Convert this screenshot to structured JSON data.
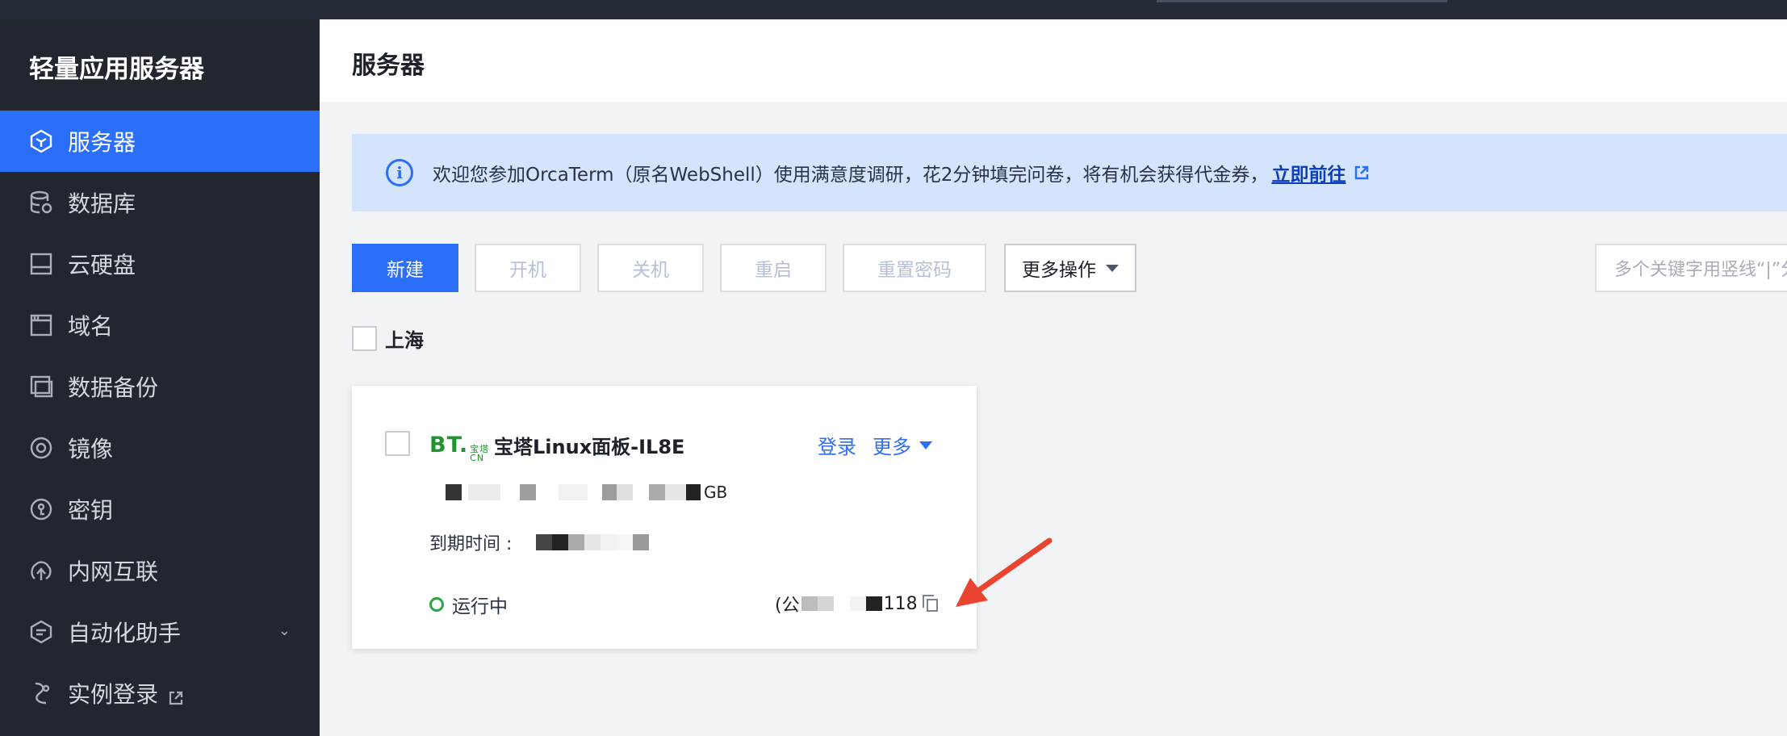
{
  "app": {
    "title": "轻量应用服务器"
  },
  "sidebar": {
    "items": [
      {
        "label": "服务器",
        "icon": "cube-icon",
        "active": true
      },
      {
        "label": "数据库",
        "icon": "database-icon"
      },
      {
        "label": "云硬盘",
        "icon": "disk-icon"
      },
      {
        "label": "域名",
        "icon": "domain-icon"
      },
      {
        "label": "数据备份",
        "icon": "backup-icon"
      },
      {
        "label": "镜像",
        "icon": "image-disc-icon"
      },
      {
        "label": "密钥",
        "icon": "key-icon"
      },
      {
        "label": "内网互联",
        "icon": "network-icon"
      },
      {
        "label": "自动化助手",
        "icon": "automation-icon",
        "expandable": true
      },
      {
        "label": "实例登录",
        "icon": "login-icon",
        "external": true
      }
    ]
  },
  "header": {
    "title": "服务器"
  },
  "notice": {
    "text": "欢迎您参加OrcaTerm（原名WebShell）使用满意度调研，花2分钟填完问卷，将有机会获得代金券，",
    "link_text": "立即前往"
  },
  "toolbar": {
    "new_label": "新建",
    "start_label": "开机",
    "stop_label": "关机",
    "restart_label": "重启",
    "reset_password_label": "重置密码",
    "more_label": "更多操作"
  },
  "search": {
    "placeholder": "多个关键字用竖线“|”分隔"
  },
  "region": {
    "label": "上海"
  },
  "instance": {
    "logo_text": "BT.",
    "logo_small_top": "宝塔",
    "logo_small_bottom": "CN",
    "name": "宝塔Linux面板-IL8E",
    "login_label": "登录",
    "more_label": "更多",
    "spec_tail": "GB",
    "expire_label": "到期时间 :",
    "status": "运行中",
    "ip_prefix": "(公",
    "ip_suffix": "118"
  },
  "colors": {
    "accent": "#2b6ef8",
    "sidebar_bg": "#22262f",
    "running": "#29a646",
    "annotation_arrow": "#e8442f"
  }
}
